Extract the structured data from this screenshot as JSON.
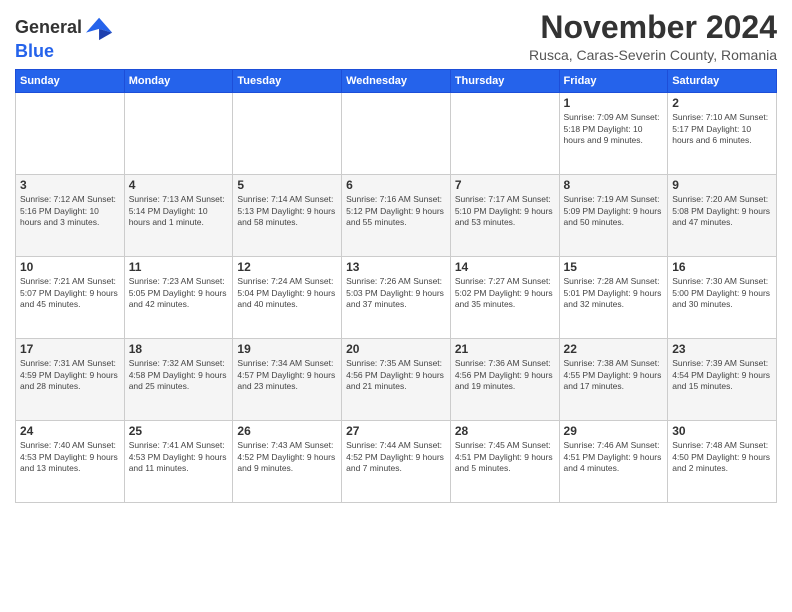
{
  "header": {
    "logo_general": "General",
    "logo_blue": "Blue",
    "month": "November 2024",
    "location": "Rusca, Caras-Severin County, Romania"
  },
  "weekdays": [
    "Sunday",
    "Monday",
    "Tuesday",
    "Wednesday",
    "Thursday",
    "Friday",
    "Saturday"
  ],
  "weeks": [
    [
      {
        "day": "",
        "info": ""
      },
      {
        "day": "",
        "info": ""
      },
      {
        "day": "",
        "info": ""
      },
      {
        "day": "",
        "info": ""
      },
      {
        "day": "",
        "info": ""
      },
      {
        "day": "1",
        "info": "Sunrise: 7:09 AM\nSunset: 5:18 PM\nDaylight: 10 hours\nand 9 minutes."
      },
      {
        "day": "2",
        "info": "Sunrise: 7:10 AM\nSunset: 5:17 PM\nDaylight: 10 hours\nand 6 minutes."
      }
    ],
    [
      {
        "day": "3",
        "info": "Sunrise: 7:12 AM\nSunset: 5:16 PM\nDaylight: 10 hours\nand 3 minutes."
      },
      {
        "day": "4",
        "info": "Sunrise: 7:13 AM\nSunset: 5:14 PM\nDaylight: 10 hours\nand 1 minute."
      },
      {
        "day": "5",
        "info": "Sunrise: 7:14 AM\nSunset: 5:13 PM\nDaylight: 9 hours\nand 58 minutes."
      },
      {
        "day": "6",
        "info": "Sunrise: 7:16 AM\nSunset: 5:12 PM\nDaylight: 9 hours\nand 55 minutes."
      },
      {
        "day": "7",
        "info": "Sunrise: 7:17 AM\nSunset: 5:10 PM\nDaylight: 9 hours\nand 53 minutes."
      },
      {
        "day": "8",
        "info": "Sunrise: 7:19 AM\nSunset: 5:09 PM\nDaylight: 9 hours\nand 50 minutes."
      },
      {
        "day": "9",
        "info": "Sunrise: 7:20 AM\nSunset: 5:08 PM\nDaylight: 9 hours\nand 47 minutes."
      }
    ],
    [
      {
        "day": "10",
        "info": "Sunrise: 7:21 AM\nSunset: 5:07 PM\nDaylight: 9 hours\nand 45 minutes."
      },
      {
        "day": "11",
        "info": "Sunrise: 7:23 AM\nSunset: 5:05 PM\nDaylight: 9 hours\nand 42 minutes."
      },
      {
        "day": "12",
        "info": "Sunrise: 7:24 AM\nSunset: 5:04 PM\nDaylight: 9 hours\nand 40 minutes."
      },
      {
        "day": "13",
        "info": "Sunrise: 7:26 AM\nSunset: 5:03 PM\nDaylight: 9 hours\nand 37 minutes."
      },
      {
        "day": "14",
        "info": "Sunrise: 7:27 AM\nSunset: 5:02 PM\nDaylight: 9 hours\nand 35 minutes."
      },
      {
        "day": "15",
        "info": "Sunrise: 7:28 AM\nSunset: 5:01 PM\nDaylight: 9 hours\nand 32 minutes."
      },
      {
        "day": "16",
        "info": "Sunrise: 7:30 AM\nSunset: 5:00 PM\nDaylight: 9 hours\nand 30 minutes."
      }
    ],
    [
      {
        "day": "17",
        "info": "Sunrise: 7:31 AM\nSunset: 4:59 PM\nDaylight: 9 hours\nand 28 minutes."
      },
      {
        "day": "18",
        "info": "Sunrise: 7:32 AM\nSunset: 4:58 PM\nDaylight: 9 hours\nand 25 minutes."
      },
      {
        "day": "19",
        "info": "Sunrise: 7:34 AM\nSunset: 4:57 PM\nDaylight: 9 hours\nand 23 minutes."
      },
      {
        "day": "20",
        "info": "Sunrise: 7:35 AM\nSunset: 4:56 PM\nDaylight: 9 hours\nand 21 minutes."
      },
      {
        "day": "21",
        "info": "Sunrise: 7:36 AM\nSunset: 4:56 PM\nDaylight: 9 hours\nand 19 minutes."
      },
      {
        "day": "22",
        "info": "Sunrise: 7:38 AM\nSunset: 4:55 PM\nDaylight: 9 hours\nand 17 minutes."
      },
      {
        "day": "23",
        "info": "Sunrise: 7:39 AM\nSunset: 4:54 PM\nDaylight: 9 hours\nand 15 minutes."
      }
    ],
    [
      {
        "day": "24",
        "info": "Sunrise: 7:40 AM\nSunset: 4:53 PM\nDaylight: 9 hours\nand 13 minutes."
      },
      {
        "day": "25",
        "info": "Sunrise: 7:41 AM\nSunset: 4:53 PM\nDaylight: 9 hours\nand 11 minutes."
      },
      {
        "day": "26",
        "info": "Sunrise: 7:43 AM\nSunset: 4:52 PM\nDaylight: 9 hours\nand 9 minutes."
      },
      {
        "day": "27",
        "info": "Sunrise: 7:44 AM\nSunset: 4:52 PM\nDaylight: 9 hours\nand 7 minutes."
      },
      {
        "day": "28",
        "info": "Sunrise: 7:45 AM\nSunset: 4:51 PM\nDaylight: 9 hours\nand 5 minutes."
      },
      {
        "day": "29",
        "info": "Sunrise: 7:46 AM\nSunset: 4:51 PM\nDaylight: 9 hours\nand 4 minutes."
      },
      {
        "day": "30",
        "info": "Sunrise: 7:48 AM\nSunset: 4:50 PM\nDaylight: 9 hours\nand 2 minutes."
      }
    ]
  ]
}
